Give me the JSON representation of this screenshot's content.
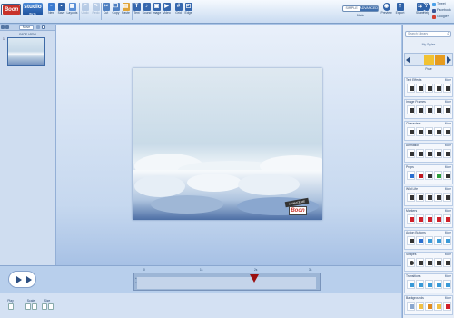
{
  "app": {
    "logo": "Boon",
    "brand": "studio",
    "version": "BETA"
  },
  "toolbar": {
    "buttons": [
      {
        "id": "new",
        "label": "New",
        "icon": "new-document-icon",
        "color": "#3b7bd0",
        "enabled": true
      },
      {
        "id": "save",
        "label": "Save",
        "icon": "save-icon",
        "color": "#2f62a8",
        "enabled": true
      },
      {
        "id": "layouts",
        "label": "Layouts",
        "icon": "layouts-icon",
        "color": "#5a8fd6",
        "enabled": true
      },
      {
        "id": "undo",
        "label": "Undo",
        "icon": "undo-icon",
        "color": "#7fa2cf",
        "enabled": false
      },
      {
        "id": "redo",
        "label": "Redo",
        "icon": "redo-icon",
        "color": "#7fa2cf",
        "enabled": false
      },
      {
        "id": "cut",
        "label": "Cut",
        "icon": "cut-icon",
        "color": "#4e80c2",
        "enabled": true
      },
      {
        "id": "copy",
        "label": "Copy",
        "icon": "copy-icon",
        "color": "#4e80c2",
        "enabled": true
      },
      {
        "id": "paste",
        "label": "Paste",
        "icon": "paste-icon",
        "color": "#e0a436",
        "enabled": true
      },
      {
        "id": "text",
        "label": "Text",
        "icon": "text-icon",
        "color": "#3567ae",
        "enabled": true
      },
      {
        "id": "sound",
        "label": "Sound",
        "icon": "sound-icon",
        "color": "#3567ae",
        "enabled": true
      },
      {
        "id": "image",
        "label": "Image",
        "icon": "image-icon",
        "color": "#3567ae",
        "enabled": true
      },
      {
        "id": "video",
        "label": "Video",
        "icon": "video-icon",
        "color": "#3567ae",
        "enabled": true
      },
      {
        "id": "grid",
        "label": "Grid",
        "icon": "grid-icon",
        "color": "#3567ae",
        "enabled": true
      },
      {
        "id": "edge",
        "label": "Edge",
        "icon": "edge-icon",
        "color": "#3567ae",
        "enabled": true
      }
    ],
    "mode": {
      "simple": "SIMPLE",
      "advanced": "ADVANCED",
      "label": "Mode",
      "active": "advanced"
    },
    "right": [
      {
        "id": "preview",
        "label": "Preview",
        "icon": "preview-icon"
      },
      {
        "id": "export",
        "label": "Export",
        "icon": "export-icon"
      },
      {
        "id": "share",
        "label": "Share",
        "icon": "share-icon"
      },
      {
        "id": "help",
        "label": "Help",
        "icon": "help-icon"
      }
    ],
    "social": [
      {
        "label": "Tweet",
        "color": "#4ba0e8"
      },
      {
        "label": "Facebook",
        "color": "#3b5998"
      },
      {
        "label": "Google+",
        "color": "#d23f31"
      }
    ]
  },
  "slides": {
    "move_label": "Move",
    "count_label": "FADE VIEW",
    "thumb_number": "1"
  },
  "timeline": {
    "ticks": [
      "0",
      "1s",
      "2s",
      "3s"
    ],
    "marker_icon": "playhead-marker-icon"
  },
  "bottom": {
    "controls": [
      {
        "label": "Play"
      },
      {
        "label": "Scale"
      },
      {
        "label": "Size"
      }
    ]
  },
  "library": {
    "search_placeholder": "Search Library",
    "my_styles": "My Styles",
    "selected_character": "Pose",
    "more": "More",
    "sections": [
      {
        "title": "Text Effects",
        "icon": "text-effects-icon"
      },
      {
        "title": "Image Frames",
        "icon": "image-frames-icon"
      },
      {
        "title": "Characters",
        "icon": "characters-icon"
      },
      {
        "title": "Animation",
        "icon": "animation-icon"
      },
      {
        "title": "Props",
        "icon": "props-icon"
      },
      {
        "title": "Wild Life",
        "icon": "wild-life-icon"
      },
      {
        "title": "Markers",
        "icon": "markers-icon"
      },
      {
        "title": "Action Buttons",
        "icon": "action-buttons-icon"
      },
      {
        "title": "Shapes",
        "icon": "shapes-icon"
      },
      {
        "title": "Transitions",
        "icon": "transitions-icon"
      },
      {
        "title": "Backgrounds",
        "icon": "backgrounds-icon"
      }
    ]
  },
  "canvas": {
    "watermark_tag": "ANIMATE ME",
    "watermark_logo": "Boon"
  }
}
